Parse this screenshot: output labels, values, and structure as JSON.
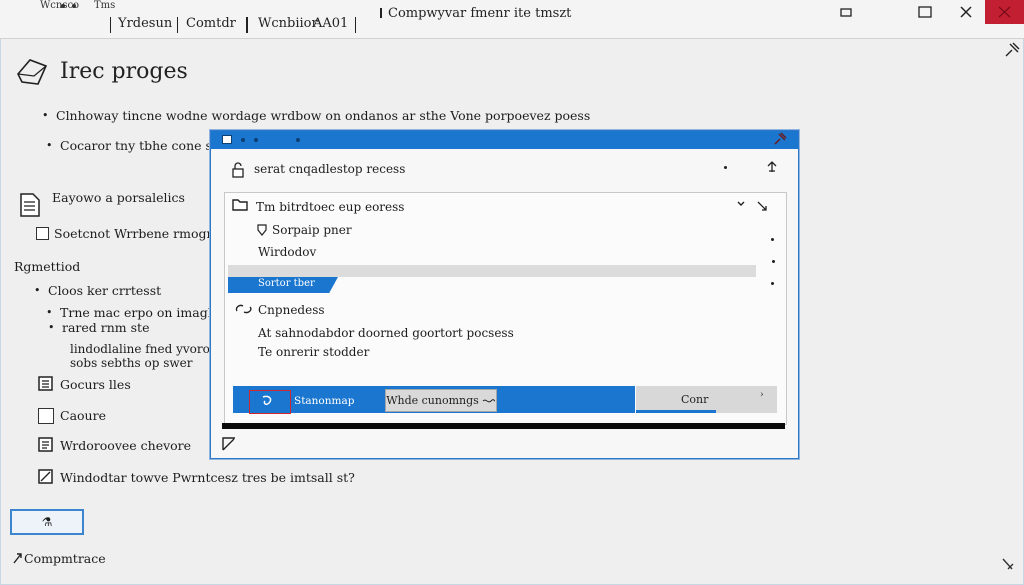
{
  "topbar": {
    "small_tab_1": "Wcnsco",
    "small_tab_2": "Tms",
    "menu_1": "Yrdesun",
    "menu_2": "Comtdr",
    "menu_3": "Wcnbiior",
    "menu_4": "AA01",
    "title": "Compwyvar fmenr ite tmszt"
  },
  "left": {
    "title": "Irec proges",
    "line1": "Clnhoway tincne wodne wordage wrdbow on ondanos ar sthe Vone porpoevez poess",
    "line2": "Cocaror tny tbhe cone stic",
    "section1_label": "Eayowo a porsalelics",
    "checkbox1_label": "Soetcnot Wrrbene rmogress",
    "section2_title": "Rgmettiod",
    "bullet1": "Cloos ker crrtesst",
    "bullet2": "Trne mac erpo on imaghne",
    "bullet2b": "rared rnm ste",
    "sub1": "lindodlaline fned yvorode",
    "sub2": "sobs sebths op swer",
    "item1": "Gocurs lles",
    "item2": "Caoure",
    "item3": "Wrdoroovee chevore",
    "item4": "Windodtar towve Pwrntcesz tres be imtsall st?",
    "button_label": "⚗",
    "footer": "Compmtrace"
  },
  "dialog": {
    "header": "serat cnqadlestop recess",
    "row1": "Tm bitrdtoec eup eoress",
    "row2": "Sorpaip pner",
    "row3": "Wirdodov",
    "row_selected": "Sortor tber",
    "row4": "Cnpnedess",
    "row5": "At sahnodabdor doorned goortort pocsess",
    "row6": "Te onrerir stodder",
    "bar_label": "Stanonmap",
    "inline_button": "Whde cunomngs",
    "gray_button": "Conr"
  },
  "colors": {
    "accent_blue": "#1a76cf",
    "close_red": "#c21f33",
    "highlight_red": "#d0272f"
  }
}
